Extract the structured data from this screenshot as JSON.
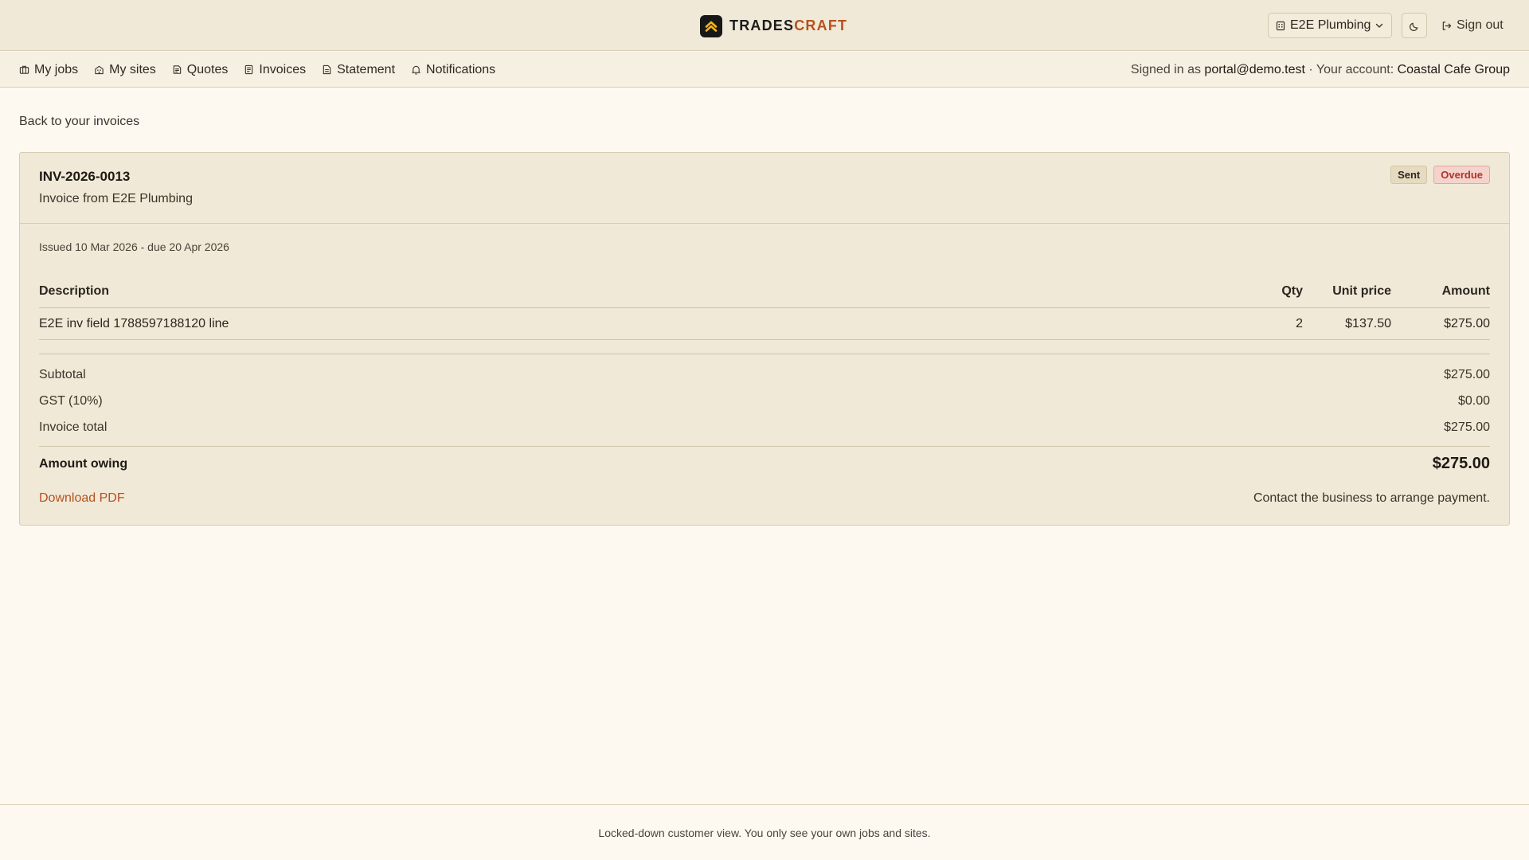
{
  "brand": {
    "part1": "TRADES",
    "part2": "CRAFT",
    "logo_icon": "chevron-up-icon",
    "accent_color": "#b6511e"
  },
  "header": {
    "business_selector": "E2E Plumbing",
    "business_icon": "building-icon",
    "theme_icon": "moon-icon",
    "sign_out_label": "Sign out",
    "sign_out_icon": "sign-out-icon"
  },
  "nav": {
    "items": [
      {
        "label": "My jobs",
        "icon": "briefcase-icon"
      },
      {
        "label": "My sites",
        "icon": "building-icon"
      },
      {
        "label": "Quotes",
        "icon": "quote-icon"
      },
      {
        "label": "Invoices",
        "icon": "invoice-icon"
      },
      {
        "label": "Statement",
        "icon": "document-icon"
      },
      {
        "label": "Notifications",
        "icon": "bell-icon"
      }
    ],
    "signed_in_prefix": "Signed in as ",
    "signed_in_email": "portal@demo.test",
    "account_prefix": " · Your account: ",
    "account_name": "Coastal Cafe Group"
  },
  "back_link": "Back to your invoices",
  "invoice": {
    "number": "INV-2026-0013",
    "from": "Invoice from E2E Plumbing",
    "badges": {
      "sent": "Sent",
      "overdue": "Overdue"
    },
    "issued": "Issued 10 Mar 2026 - due 20 Apr 2026",
    "columns": {
      "description": "Description",
      "qty": "Qty",
      "unit_price": "Unit price",
      "amount": "Amount"
    },
    "lines": [
      {
        "description": "E2E inv field 1788597188120 line",
        "qty": "2",
        "unit_price": "$137.50",
        "amount": "$275.00"
      }
    ],
    "totals": {
      "subtotal_label": "Subtotal",
      "subtotal": "$275.00",
      "gst_label": "GST (10%)",
      "gst": "$0.00",
      "total_label": "Invoice total",
      "total": "$275.00"
    },
    "owing_label": "Amount owing",
    "owing": "$275.00",
    "download_label": "Download PDF",
    "contact_note": "Contact the business to arrange payment."
  },
  "footer": "Locked-down customer view. You only see your own jobs and sites."
}
